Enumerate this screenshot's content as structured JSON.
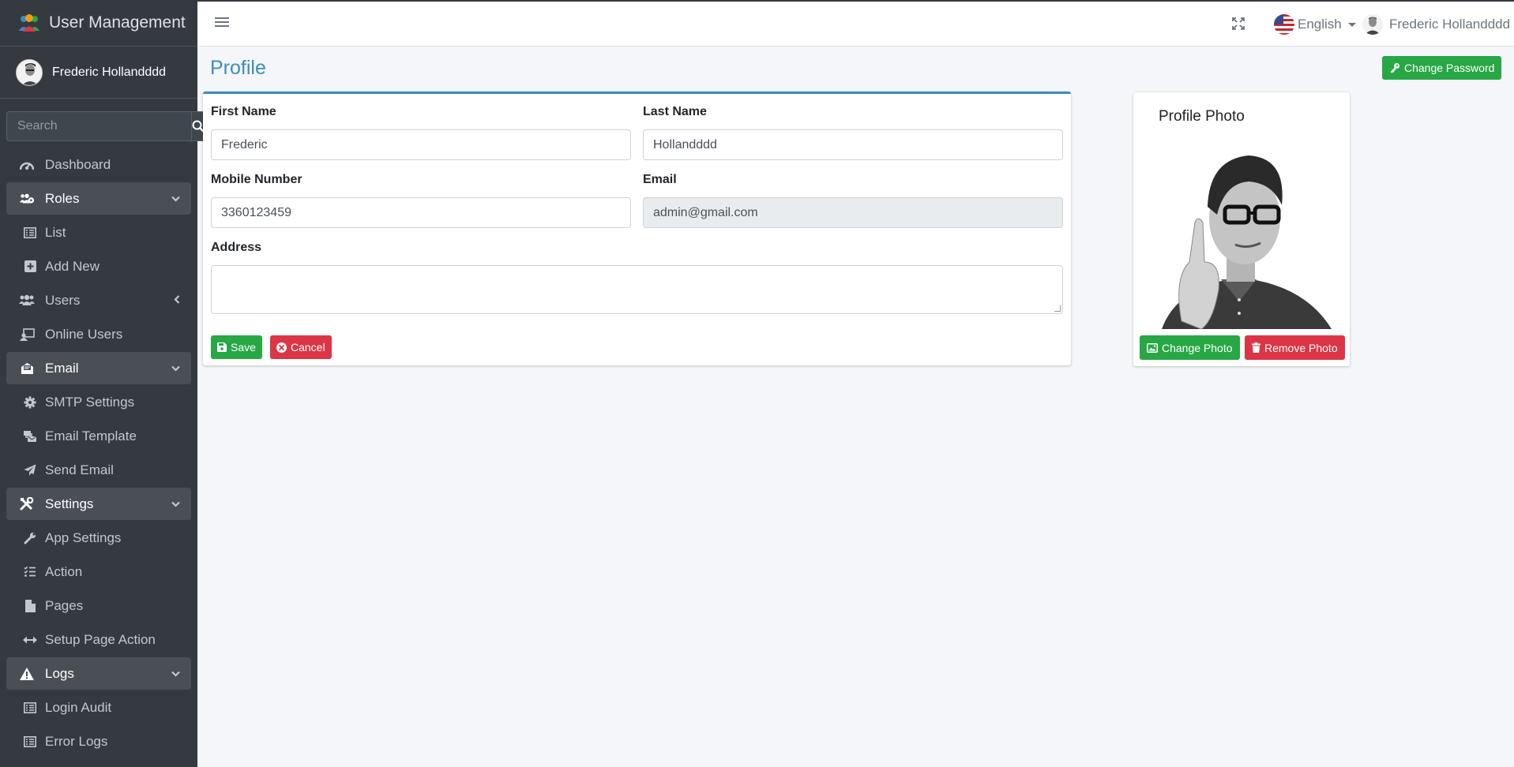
{
  "app": {
    "title": "User Management"
  },
  "user": {
    "name": "Frederic Hollandddd"
  },
  "sidebar": {
    "search_placeholder": "Search",
    "items": [
      {
        "label": "Dashboard",
        "icon": "tachometer-icon",
        "level": "top"
      },
      {
        "label": "Roles",
        "icon": "users-cog-icon",
        "level": "parent",
        "chevron": "down"
      },
      {
        "label": "List",
        "icon": "list-icon",
        "level": "sub"
      },
      {
        "label": "Add New",
        "icon": "plus-square-icon",
        "level": "sub"
      },
      {
        "label": "Users",
        "icon": "users-icon",
        "level": "top",
        "chevron": "left"
      },
      {
        "label": "Online Users",
        "icon": "online-users-icon",
        "level": "top"
      },
      {
        "label": "Email",
        "icon": "envelope-open-icon",
        "level": "parent",
        "chevron": "down"
      },
      {
        "label": "SMTP Settings",
        "icon": "gear-icon",
        "level": "sub"
      },
      {
        "label": "Email Template",
        "icon": "mail-bulk-icon",
        "level": "sub"
      },
      {
        "label": "Send Email",
        "icon": "paper-plane-icon",
        "level": "sub"
      },
      {
        "label": "Settings",
        "icon": "tools-icon",
        "level": "parent",
        "chevron": "down"
      },
      {
        "label": "App Settings",
        "icon": "wrench-icon",
        "level": "sub"
      },
      {
        "label": "Action",
        "icon": "tasks-icon",
        "level": "sub"
      },
      {
        "label": "Pages",
        "icon": "file-icon",
        "level": "sub"
      },
      {
        "label": "Setup Page Action",
        "icon": "arrows-h-icon",
        "level": "sub"
      },
      {
        "label": "Logs",
        "icon": "warning-icon",
        "level": "parent",
        "chevron": "down"
      },
      {
        "label": "Login Audit",
        "icon": "list-alt-icon",
        "level": "sub"
      },
      {
        "label": "Error Logs",
        "icon": "list-alt-icon",
        "level": "sub"
      }
    ]
  },
  "topbar": {
    "language": "English",
    "user_name": "Frederic Hollandddd"
  },
  "page": {
    "title": "Profile",
    "change_password_label": "Change Password"
  },
  "form": {
    "first_name_label": "First Name",
    "first_name_value": "Frederic",
    "last_name_label": "Last Name",
    "last_name_value": "Hollandddd",
    "mobile_label": "Mobile Number",
    "mobile_value": "3360123459",
    "email_label": "Email",
    "email_value": "admin@gmail.com",
    "address_label": "Address",
    "address_value": "",
    "save_label": "Save",
    "cancel_label": "Cancel"
  },
  "photo_card": {
    "title": "Profile Photo",
    "change_label": "Change Photo",
    "remove_label": "Remove Photo"
  },
  "colors": {
    "sidebar": "#343a40",
    "accent": "#3c8dbc",
    "success": "#28a745",
    "danger": "#dc3545"
  }
}
